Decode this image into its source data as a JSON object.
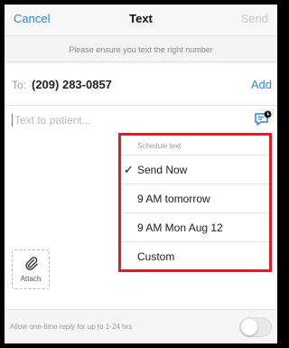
{
  "colors": {
    "accent": "#2f86d6",
    "highlight_border": "#e01e1e",
    "disabled": "#c8c8c8"
  },
  "header": {
    "cancel": "Cancel",
    "title": "Text",
    "send": "Send"
  },
  "notice": "Please ensure you text the right number",
  "recipient": {
    "label": "To:",
    "phone": "(209) 283-0857",
    "add": "Add"
  },
  "message": {
    "placeholder": "Text to patient...",
    "schedule_icon": "scheduled-message-icon"
  },
  "schedule_menu": {
    "title": "Schedule text",
    "items": [
      {
        "label": "Send Now",
        "selected": true
      },
      {
        "label": "9 AM tomorrow",
        "selected": false
      },
      {
        "label": "9 AM Mon Aug 12",
        "selected": false
      },
      {
        "label": "Custom",
        "selected": false
      }
    ]
  },
  "attach": {
    "label": "Attach",
    "icon": "paperclip-icon"
  },
  "footer": {
    "label": "Allow one-time reply for up to 1-24 hrs",
    "toggle_on": false
  }
}
